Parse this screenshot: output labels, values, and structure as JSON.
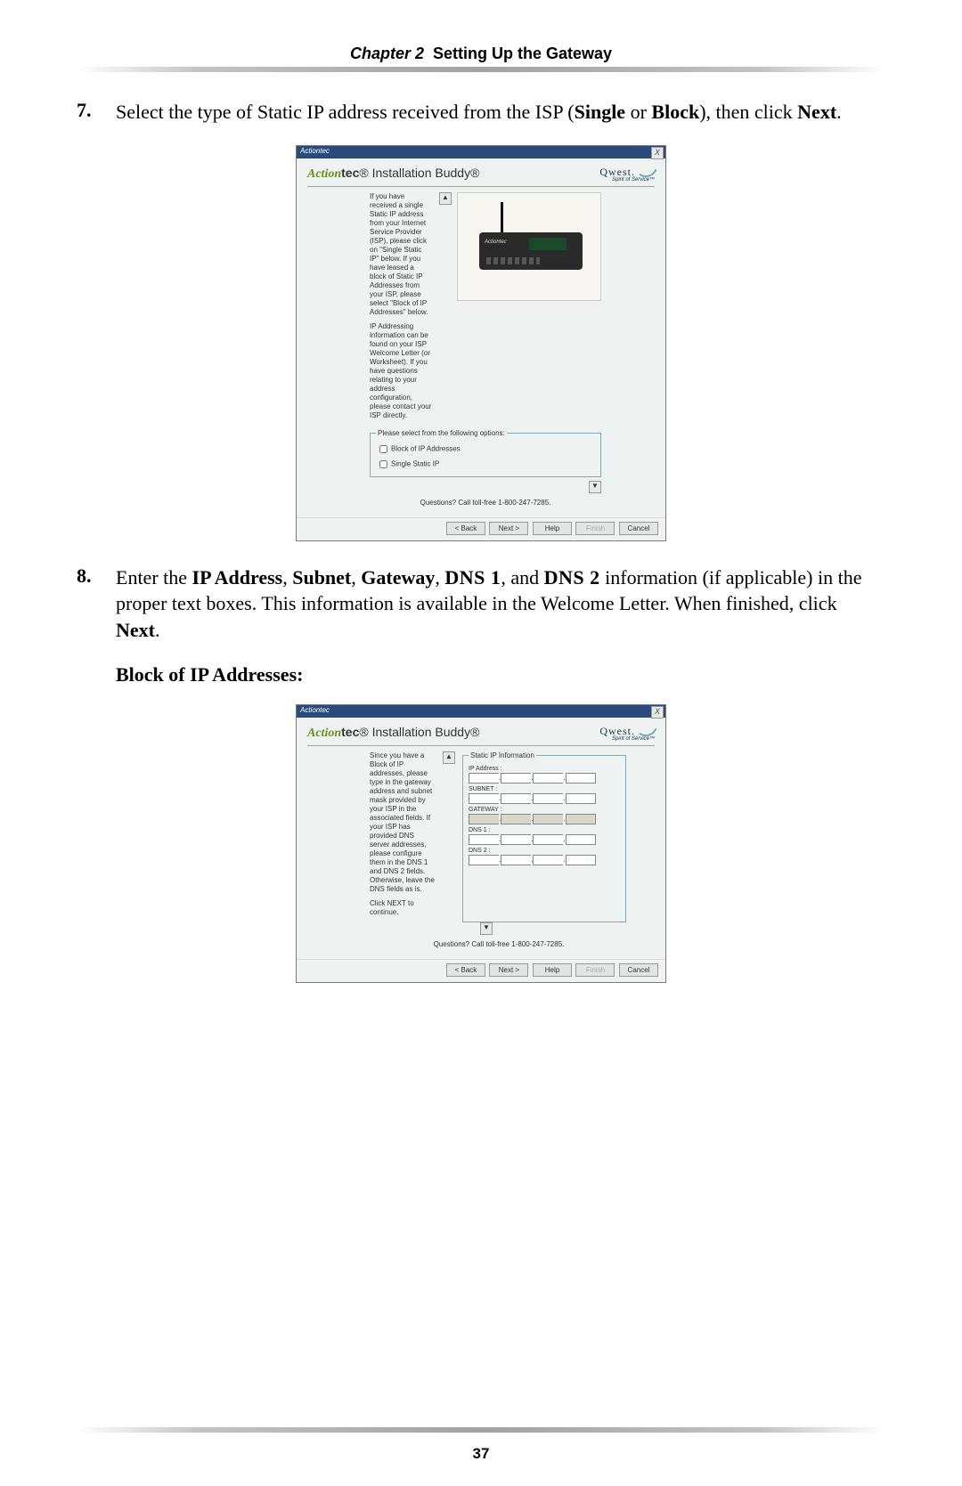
{
  "header": {
    "chapter_label": "Chapter 2",
    "title": "Setting Up the Gateway"
  },
  "page_number": "37",
  "steps": {
    "s7": {
      "num": "7.",
      "text_pre": "Select the type of Static IP address received from the ISP (",
      "bold1": "Single",
      "mid1": " or ",
      "bold2": "Block",
      "mid2": "), then click ",
      "bold3": "Next",
      "post": "."
    },
    "s8": {
      "num": "8.",
      "pre": "Enter the ",
      "b1": "IP Address",
      "c1": ", ",
      "b2": "Subnet",
      "c2": ", ",
      "b3": "Gateway",
      "c3": ", ",
      "b4": "DNS 1",
      "c4": ", and ",
      "b5": "DNS 2",
      "tail1": " information (if applicable) in the proper text boxes. This information is available in the Welcome Letter. When finished, click ",
      "b6": "Next",
      "tail2": "."
    }
  },
  "subhead": "Block of IP Addresses:",
  "wizard_common": {
    "titlebar": "Actiontec",
    "brand_ac": "Action",
    "brand_tec": "tec",
    "brand_suffix": "® Installation Buddy®",
    "qwest": "Qwest.",
    "qwest_tag": "Spirit of Service™",
    "questions": "Questions? Call toll-free 1-800-247-7285.",
    "btn_back": "< Back",
    "btn_next": "Next >",
    "btn_help": "Help",
    "btn_finish": "Finish",
    "btn_cancel": "Cancel",
    "close": "X"
  },
  "wizard1": {
    "para1": "If you have received a single Static IP address from your Internet Service Provider (ISP), please click on \"Single Static IP\" below. If you have leased a block of Static IP Addresses from your ISP, please select \"Block of IP Addresses\" below.",
    "para2": "IP Addressing information can be found on your ISP Welcome Letter (or Worksheet). If you have questions relating to your address configuration, please contact your ISP directly.",
    "legend": "Please select from the following options:",
    "opt1": "Block of IP Addresses",
    "opt2": "Single Static IP",
    "router_label": "DSL Gateway",
    "router_brand": "Actiontec"
  },
  "wizard2": {
    "para1": "Since you have a Block of IP addresses, please type in the gateway address and subnet mask provided by your ISP in the associated fields. If your ISP has provided DNS server addresses, please configure them in the DNS 1 and DNS 2 fields. Otherwise, leave the DNS fields as is.",
    "para2": "Click NEXT to continue.",
    "legend": "Static IP Information",
    "f_ip": "IP Address :",
    "f_subnet": "SUBNET :",
    "f_gateway": "GATEWAY :",
    "f_dns1": "DNS 1 :",
    "f_dns2": "DNS 2 :"
  }
}
